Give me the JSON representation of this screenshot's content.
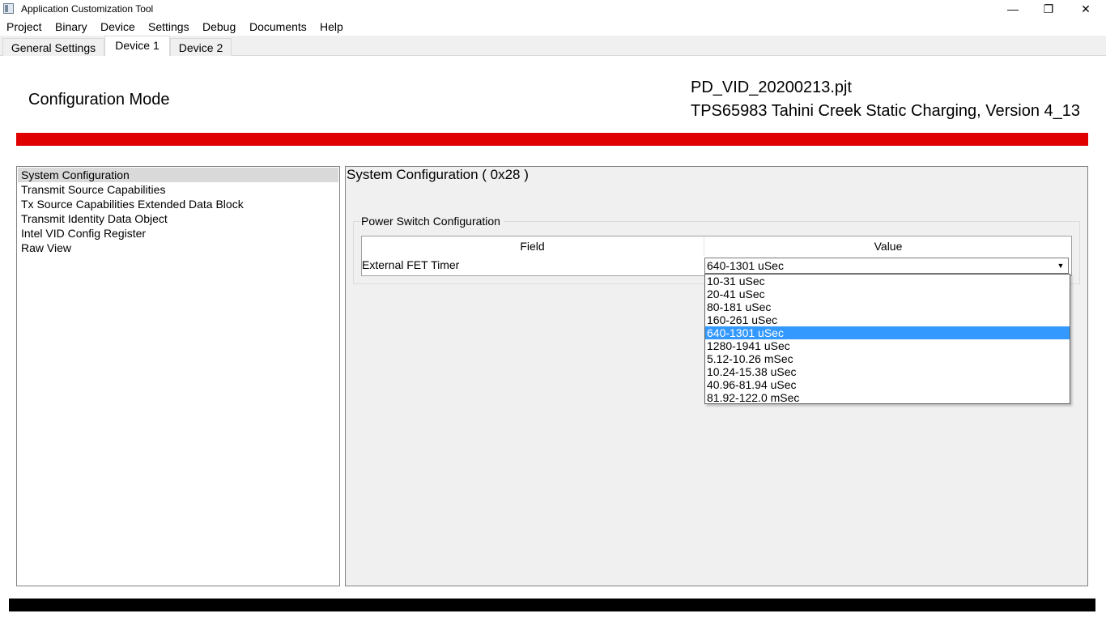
{
  "window": {
    "title": "Application Customization Tool",
    "minimize_glyph": "—",
    "restore_glyph": "❐",
    "close_glyph": "✕"
  },
  "menu": [
    "Project",
    "Binary",
    "Device",
    "Settings",
    "Debug",
    "Documents",
    "Help"
  ],
  "tabs": [
    "General Settings",
    "Device 1",
    "Device 2"
  ],
  "active_tab": "Device 1",
  "header": {
    "mode": "Configuration Mode",
    "project_file": "PD_VID_20200213.pjt",
    "device_desc": "TPS65983 Tahini Creek Static Charging, Version 4_13",
    "accent_color": "#e00000"
  },
  "nav": {
    "items": [
      "System Configuration",
      "Transmit Source Capabilities",
      "Tx Source Capabilities Extended Data Block",
      "Transmit Identity Data Object",
      "Intel VID Config Register",
      "Raw View"
    ],
    "selected": "System Configuration"
  },
  "detail": {
    "title": "System Configuration  ( 0x28 )",
    "group_title": "Power Switch Configuration",
    "columns": [
      "Field",
      "Value"
    ],
    "row": {
      "field": "External FET Timer",
      "value": "640-1301 uSec"
    },
    "dropdown_arrow": "▼",
    "options": [
      "10-31 uSec",
      "20-41 uSec",
      "80-181 uSec",
      "160-261 uSec",
      "640-1301 uSec",
      "1280-1941 uSec",
      "5.12-10.26 mSec",
      "10.24-15.38 uSec",
      "40.96-81.94 uSec",
      "81.92-122.0 mSec"
    ],
    "selected_option": "640-1301 uSec",
    "highlight_color": "#3399ff"
  }
}
